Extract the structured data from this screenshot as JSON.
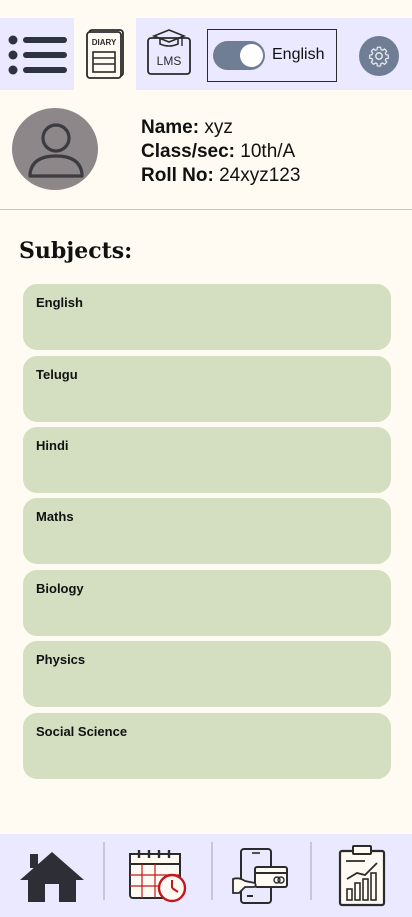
{
  "topbar": {
    "diary_label": "DIARY",
    "lms_label": "LMS",
    "language": "English",
    "toggle_on": true
  },
  "profile": {
    "name_label": "Name:",
    "name": "xyz",
    "class_label": "Class/sec:",
    "class": "10th/A",
    "roll_label": "Roll No:",
    "roll": "24xyz123"
  },
  "subjects": {
    "title": "Subjects:",
    "items": [
      "English",
      "Telugu",
      "Hindi",
      "Maths",
      "Biology",
      "Physics",
      "Social Science"
    ]
  },
  "bottom_nav": {
    "items": [
      "home-icon",
      "calendar-clock-icon",
      "mobile-payment-icon",
      "report-chart-icon"
    ]
  },
  "colors": {
    "background": "#fffaf2",
    "bar": "#ebe9ff",
    "card": "#d3dfc0",
    "toggle": "#6f7e95",
    "accent_red": "#c4171d"
  }
}
